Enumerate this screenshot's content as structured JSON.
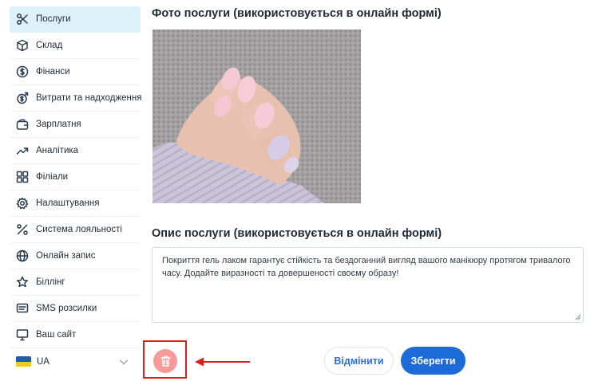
{
  "sidebar": {
    "items": [
      {
        "label": "Послуги",
        "icon": "scissors-icon",
        "active": true
      },
      {
        "label": "Склад",
        "icon": "box-icon"
      },
      {
        "label": "Фінанси",
        "icon": "dollar-circle-icon"
      },
      {
        "label": "Витрати та надходження",
        "icon": "money-flow-icon"
      },
      {
        "label": "Зарплатня",
        "icon": "wallet-icon"
      },
      {
        "label": "Аналітика",
        "icon": "trend-up-icon"
      },
      {
        "label": "Філіали",
        "icon": "grid-icon"
      },
      {
        "label": "Налаштування",
        "icon": "gear-icon"
      },
      {
        "label": "Система лояльності",
        "icon": "percent-icon"
      },
      {
        "label": "Онлайн запис",
        "icon": "globe-icon"
      },
      {
        "label": "Біллінг",
        "icon": "star-icon"
      },
      {
        "label": "SMS розсилки",
        "icon": "message-icon"
      },
      {
        "label": "Ваш сайт",
        "icon": "monitor-icon"
      }
    ],
    "language": {
      "code": "UA",
      "icon": "ukraine-flag-icon"
    }
  },
  "photo_section": {
    "title": "Фото послуги (використовується в онлайн формі)"
  },
  "description_section": {
    "title": "Опис послуги (використовується в онлайн формі)",
    "text": "Покриття гель лаком гарантує стійкість та бездоганний вигляд вашого манікюру протягом тривалого часу. Додайте виразності та довершеності своєму образу!"
  },
  "actions": {
    "cancel_label": "Відмінити",
    "save_label": "Зберегти",
    "delete_icon": "trash-icon"
  },
  "colors": {
    "active_nav_bg": "#dcf1fa",
    "primary": "#1d6ad9",
    "delete_bg": "#f79a9a",
    "highlight_red": "#e01c1c"
  }
}
